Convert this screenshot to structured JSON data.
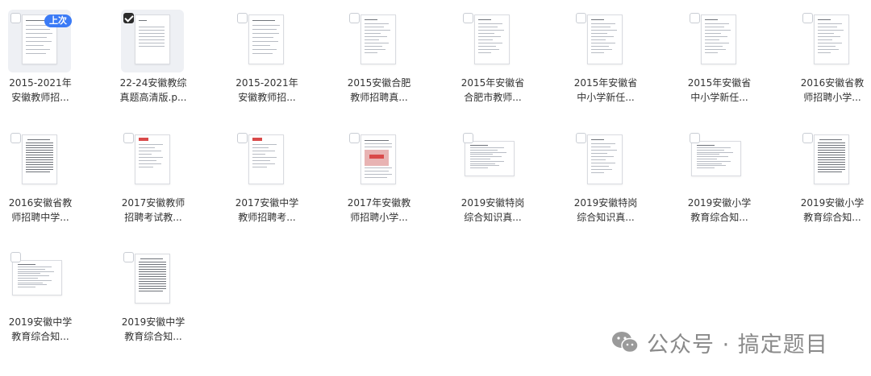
{
  "files": [
    {
      "name": "2015-2021年\n安徽教师招...",
      "checked": false,
      "badge": "上次",
      "orientation": "portrait",
      "style": "blank"
    },
    {
      "name": "22-24安徽教综\n真题高清版.p...",
      "checked": true,
      "orientation": "portrait",
      "style": "toc"
    },
    {
      "name": "2015-2021年\n安徽教师招...",
      "checked": false,
      "orientation": "portrait",
      "style": "blank"
    },
    {
      "name": "2015安徽合肥\n教师招聘真...",
      "checked": false,
      "orientation": "portrait",
      "style": "text"
    },
    {
      "name": "2015年安徽省\n合肥市教师...",
      "checked": false,
      "orientation": "portrait",
      "style": "text"
    },
    {
      "name": "2015年安徽省\n中小学新任...",
      "checked": false,
      "orientation": "portrait",
      "style": "text"
    },
    {
      "name": "2015年安徽省\n中小学新任...",
      "checked": false,
      "orientation": "portrait",
      "style": "text"
    },
    {
      "name": "2016安徽省教\n师招聘小学...",
      "checked": false,
      "orientation": "portrait",
      "style": "text"
    },
    {
      "name": "2016安徽省教\n师招聘中学...",
      "checked": false,
      "orientation": "portrait",
      "style": "dense"
    },
    {
      "name": "2017安徽教师\n招聘考试教...",
      "checked": false,
      "orientation": "portrait",
      "style": "redhead"
    },
    {
      "name": "2017安徽中学\n教师招聘考...",
      "checked": false,
      "orientation": "portrait",
      "style": "redhead"
    },
    {
      "name": "2017年安徽教\n师招聘小学...",
      "checked": false,
      "orientation": "portrait",
      "style": "stamp"
    },
    {
      "name": "2019安徽特岗\n综合知识真...",
      "checked": false,
      "orientation": "landscape",
      "style": "text"
    },
    {
      "name": "2019安徽特岗\n综合知识真...",
      "checked": false,
      "orientation": "portrait",
      "style": "text"
    },
    {
      "name": "2019安徽小学\n教育综合知...",
      "checked": false,
      "orientation": "landscape",
      "style": "text"
    },
    {
      "name": "2019安徽小学\n教育综合知...",
      "checked": false,
      "orientation": "portrait",
      "style": "dense"
    },
    {
      "name": "2019安徽中学\n教育综合知...",
      "checked": false,
      "orientation": "landscape",
      "style": "text"
    },
    {
      "name": "2019安徽中学\n教育综合知...",
      "checked": false,
      "orientation": "portrait",
      "style": "dense"
    }
  ],
  "watermark": {
    "text": "公众号 · 搞定题目",
    "icon": "wechat-icon"
  }
}
